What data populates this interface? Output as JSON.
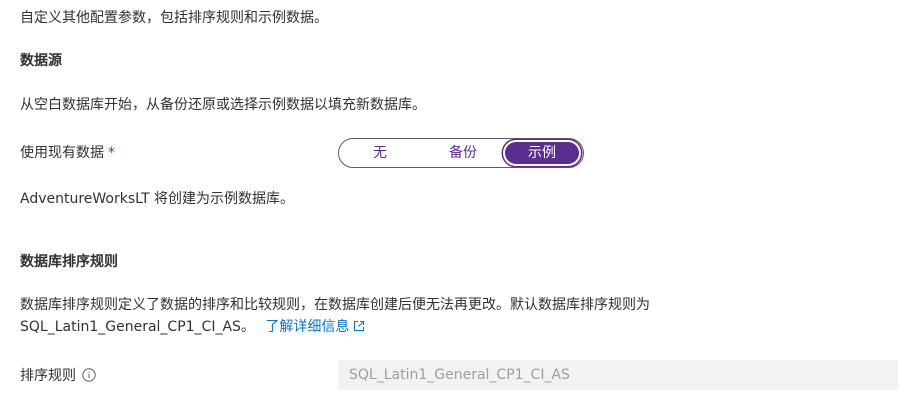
{
  "intro": {
    "text": "自定义其他配置参数，包括排序规则和示例数据。"
  },
  "data_source": {
    "heading": "数据源",
    "description": "从空白数据库开始，从备份还原或选择示例数据以填充新数据库。",
    "field_label": "使用现有数据",
    "required_marker": "*",
    "options": [
      "无",
      "备份",
      "示例"
    ],
    "selected": "示例",
    "note": "AdventureWorksLT 将创建为示例数据库。"
  },
  "collation": {
    "heading": "数据库排序规则",
    "description_line1": "数据库排序规则定义了数据的排序和比较规则，在数据库创建后便无法再更改。默认数据库排序规则为",
    "description_line2": "SQL_Latin1_General_CP1_CI_AS。",
    "learn_more": "了解详细信息",
    "field_label": "排序规则",
    "field_value": "SQL_Latin1_General_CP1_CI_AS"
  },
  "colors": {
    "accent": "#5c2d91",
    "link": "#0078d4",
    "required": "#a4262c",
    "disabled_bg": "#f3f2f1"
  },
  "icons": [
    "info-icon",
    "external-link-icon"
  ]
}
